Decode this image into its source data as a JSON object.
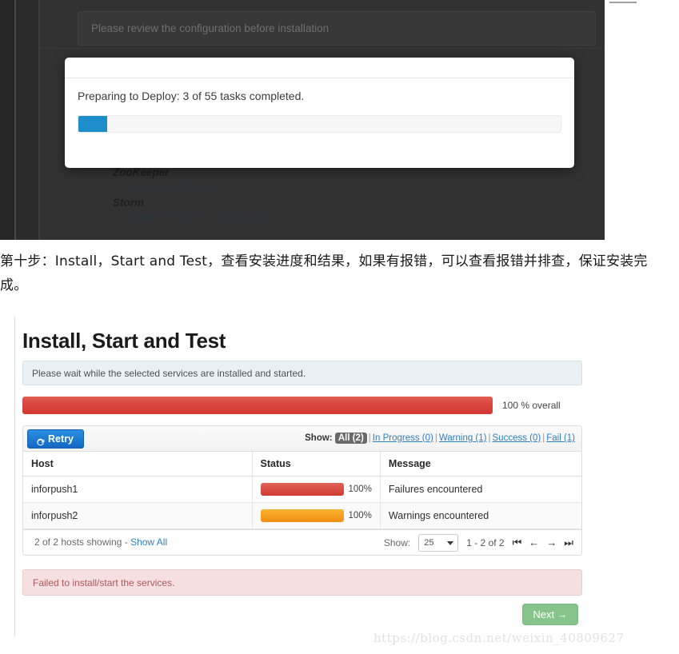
{
  "top_screenshot": {
    "review_banner": "Please review the configuration before installation",
    "modal": {
      "title": "Preparing to Deploy: 3 of 55 tasks completed.",
      "progress_percent": 6,
      "progress_color": "#1d8ecb"
    },
    "background_tree": {
      "zookeeper_label": "ZooKeeper",
      "zookeeper_server": "Server : 3 hosts",
      "storm_label": "Storm",
      "storm_drpc": "DRPC Server : slave2.org.cn"
    }
  },
  "caption": "第十步：Install，Start and Test，查看安装进度和结果，如果有报错，可以查看报错并排查，保证安装完成。",
  "bottom_screenshot": {
    "page_title": "Install, Start and Test",
    "info_message": "Please wait while the selected services are installed and started.",
    "overall": {
      "percent": 100,
      "label": "100 % overall",
      "bar_color": "#d8453e"
    },
    "toolbar": {
      "retry_label": "Retry",
      "show_label": "Show:",
      "filters": [
        {
          "label": "All (2)",
          "active": true
        },
        {
          "label": "In Progress (0)",
          "active": false
        },
        {
          "label": "Warning (1)",
          "active": false
        },
        {
          "label": "Success (0)",
          "active": false
        },
        {
          "label": "Fail (1)",
          "active": false
        }
      ],
      "separator": "|"
    },
    "table": {
      "columns": [
        "Host",
        "Status",
        "Message"
      ],
      "rows": [
        {
          "host": "inforpush1",
          "percent": "100%",
          "bar_state": "fail",
          "bar_color": "#d2392f",
          "message": "Failures encountered"
        },
        {
          "host": "inforpush2",
          "percent": "100%",
          "bar_state": "warn",
          "bar_color": "#f08e12",
          "message": "Warnings encountered"
        }
      ]
    },
    "footer": {
      "hosts_showing": "2 of 2 hosts showing - ",
      "show_all_link": "Show All",
      "show_label": "Show:",
      "page_size": "25",
      "range": "1 - 2 of 2",
      "pager_first": "⏮",
      "pager_prev": "←",
      "pager_next": "→",
      "pager_last": "⏭"
    },
    "error_alert": "Failed to install/start the services.",
    "next_button": "Next →"
  },
  "watermark": "https://blog.csdn.net/weixin_40809627"
}
